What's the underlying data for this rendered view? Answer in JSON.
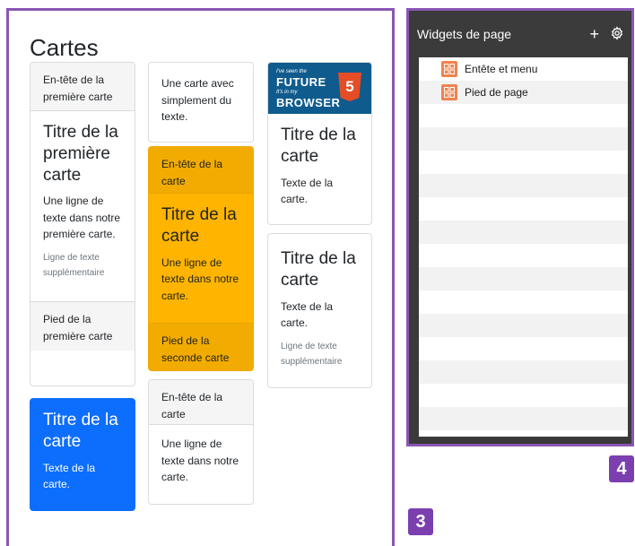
{
  "left": {
    "title": "Cartes",
    "col1": {
      "card1": {
        "header": "En-tête de la première carte",
        "title": "Titre de la première carte",
        "text": "Une ligne de texte dans notre première carte.",
        "muted": "Ligne de texte supplémentaire",
        "footer": "Pied de la première carte"
      },
      "card2": {
        "title": "Titre de la carte",
        "text": "Texte de la carte."
      }
    },
    "col2": {
      "card1": {
        "text": "Une carte avec simplement du texte."
      },
      "card2": {
        "header": "En-tête de la carte",
        "title": "Titre de la carte",
        "text": "Une ligne de texte dans notre carte.",
        "footer": "Pied de la seconde carte"
      },
      "card3": {
        "header": "En-tête de la carte",
        "text": "Une ligne de texte dans notre carte."
      }
    },
    "col3": {
      "banner": {
        "line1": "I've seen the",
        "line2": "FUTURE",
        "line3": "It's in my",
        "line4": "BROWSER",
        "badge": "5"
      },
      "card1": {
        "title": "Titre de la carte",
        "text": "Texte de la carte."
      },
      "card2": {
        "title": "Titre de la carte",
        "text": "Texte de la carte.",
        "muted": "Ligne de texte supplémentaire"
      }
    }
  },
  "right": {
    "header": {
      "title": "Widgets de page",
      "add_icon": "+",
      "settings_icon": "gear-icon"
    },
    "items": [
      {
        "label": "Entête et menu",
        "icon": "widget-icon"
      },
      {
        "label": "Pied de page",
        "icon": "widget-icon"
      }
    ]
  },
  "badges": {
    "left": "3",
    "right": "4"
  },
  "colors": {
    "panel_border": "#8a56b4",
    "warning": "#ffb400",
    "primary": "#0d6efd",
    "widget_icon": "#f0824e"
  }
}
